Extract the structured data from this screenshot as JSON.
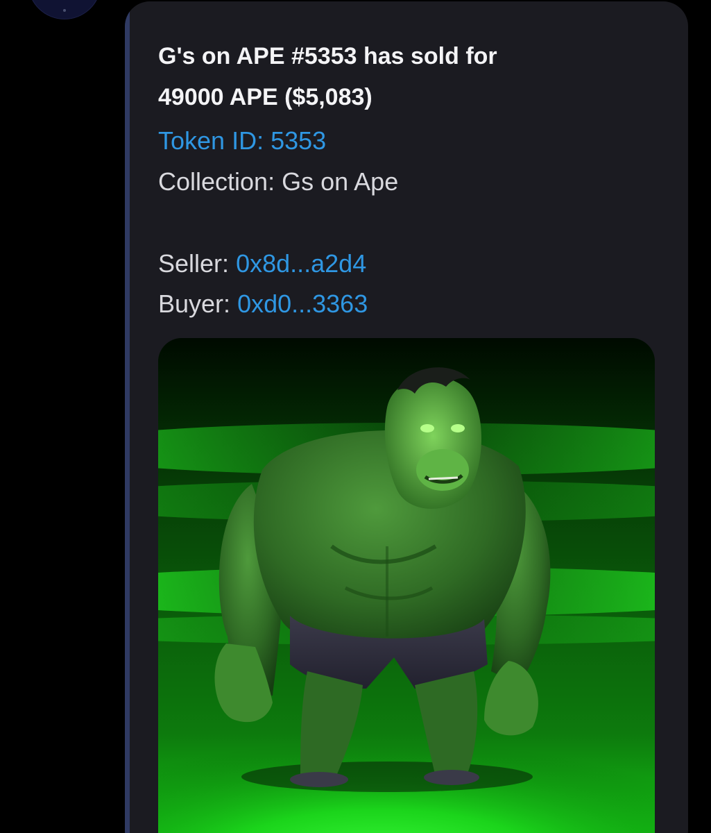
{
  "message": {
    "title_line1": "G's on APE #5353 has sold for",
    "title_line2": "49000 APE ($5,083)",
    "token_id_text": "Token ID: 5353",
    "collection_label": "Collection:",
    "collection_value": "Gs on Ape",
    "seller_label": "Seller:",
    "seller_address": "0x8d...a2d4",
    "buyer_label": "Buyer:",
    "buyer_address": "0xd0...3363"
  },
  "image": {
    "subject": "green-hulk-ape-nft"
  },
  "colors": {
    "background": "#000000",
    "bubble": "#1b1b21",
    "bubble_accent": "#2f3a63",
    "title_text": "#f4f4f6",
    "body_text": "#d9d9de",
    "link": "#2f97e3",
    "neon_green": "#22ff22"
  }
}
